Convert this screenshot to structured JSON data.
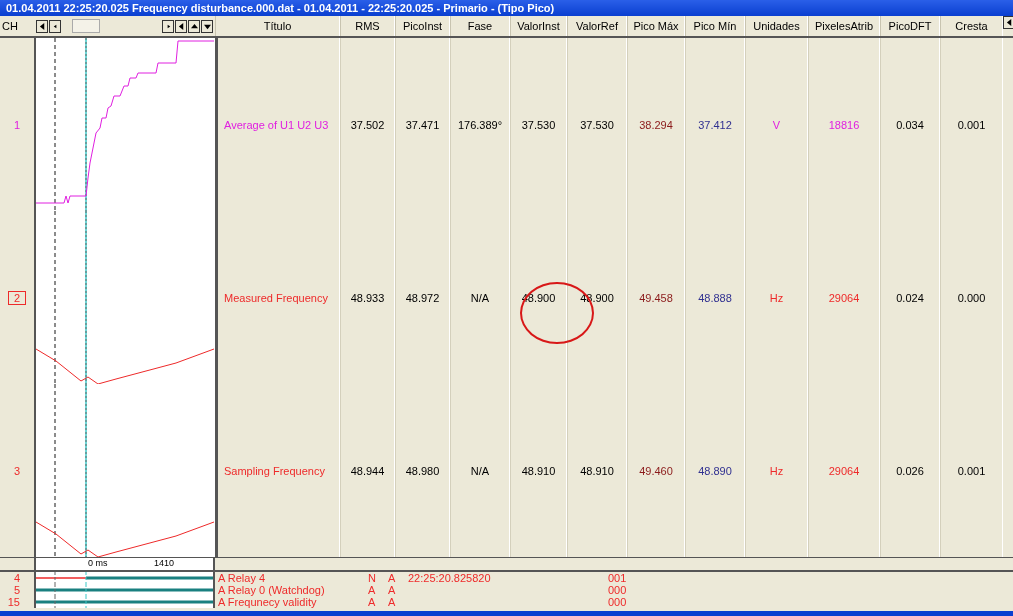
{
  "window": {
    "title": "01.04.2011 22:25:20.025 Frequency disturbance.000.dat - 01.04.2011 - 22:25:20.025 - Primario - (Tipo Pico)"
  },
  "header": {
    "ch_label": "CH",
    "columns": [
      "Título",
      "RMS",
      "PicoInst",
      "Fase",
      "ValorInst",
      "ValorRef",
      "Pico Máx",
      "Pico Mín",
      "Unidades",
      "PixelesAtrib",
      "PicoDFT",
      "Cresta"
    ]
  },
  "channels": [
    {
      "number": "1",
      "selected": false,
      "color": "#e020e0",
      "kind": "rise",
      "cells": [
        "Average of U1 U2 U3",
        "37.502",
        "37.471",
        "176.389°",
        "37.530",
        "37.530",
        "38.294",
        "37.412",
        "V",
        "18816",
        "0.034",
        "0.001"
      ]
    },
    {
      "number": "2",
      "selected": true,
      "color": "#ee2a2a",
      "kind": "dip",
      "cells": [
        "Measured Frequency",
        "48.933",
        "48.972",
        "N/A",
        "48.900",
        "48.900",
        "49.458",
        "48.888",
        "Hz",
        "29064",
        "0.024",
        "0.000"
      ]
    },
    {
      "number": "3",
      "selected": false,
      "color": "#ee2a2a",
      "kind": "dip",
      "cells": [
        "Sampling Frequency",
        "48.944",
        "48.980",
        "N/A",
        "48.910",
        "48.910",
        "49.460",
        "48.890",
        "Hz",
        "29064",
        "0.026",
        "0.001"
      ]
    }
  ],
  "time_axis": {
    "start_label": "0 ms",
    "end_label": "1410"
  },
  "digital_channels": [
    {
      "number": "4",
      "label": "A  Relay  4",
      "flag_1": "N",
      "flag_2": "A",
      "time": "22:25:20.825820",
      "value": "001",
      "triggered": true
    },
    {
      "number": "5",
      "label": "A  Relay  0 (Watchdog)",
      "flag_1": "A",
      "flag_2": "A",
      "value": "000",
      "triggered": false
    },
    {
      "number": "15",
      "label": "A  Frequnecy validity",
      "flag_1": "A",
      "flag_2": "A",
      "value": "000",
      "triggered": false
    }
  ]
}
